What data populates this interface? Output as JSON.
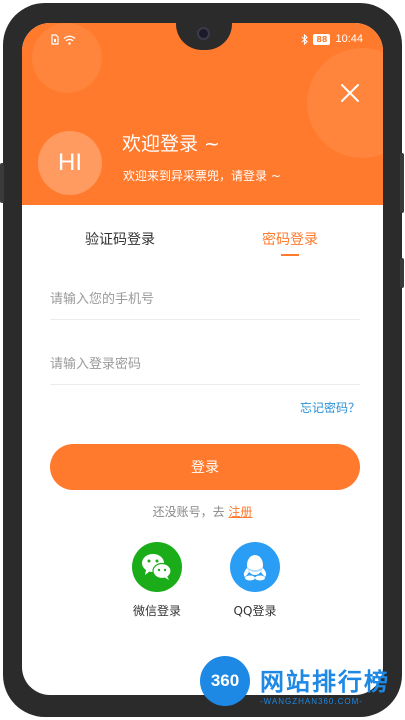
{
  "status_bar": {
    "battery": "88",
    "time": "10:44"
  },
  "header": {
    "avatar_text": "HI",
    "welcome_title": "欢迎登录 ~",
    "welcome_subtitle": "欢迎来到异采票兜，请登录 ~"
  },
  "tabs": [
    {
      "label": "验证码登录",
      "active": false
    },
    {
      "label": "密码登录",
      "active": true
    }
  ],
  "form": {
    "phone_placeholder": "请输入您的手机号",
    "phone_value": "",
    "password_placeholder": "请输入登录密码",
    "password_value": "",
    "forgot_label": "忘记密码？",
    "login_label": "登录",
    "no_account_text": "还没账号，去 ",
    "register_label": "注册"
  },
  "social": [
    {
      "label": "微信登录",
      "icon": "wechat-icon"
    },
    {
      "label": "QQ登录",
      "icon": "qq-icon"
    }
  ],
  "watermark": {
    "logo": "360",
    "title": "网站排行榜",
    "subtitle": "-WANGZHAN360.COM-"
  },
  "colors": {
    "accent": "#ff7a2c",
    "link": "#2a8fd6",
    "wechat": "#1aad19",
    "qq": "#2a9df4"
  }
}
